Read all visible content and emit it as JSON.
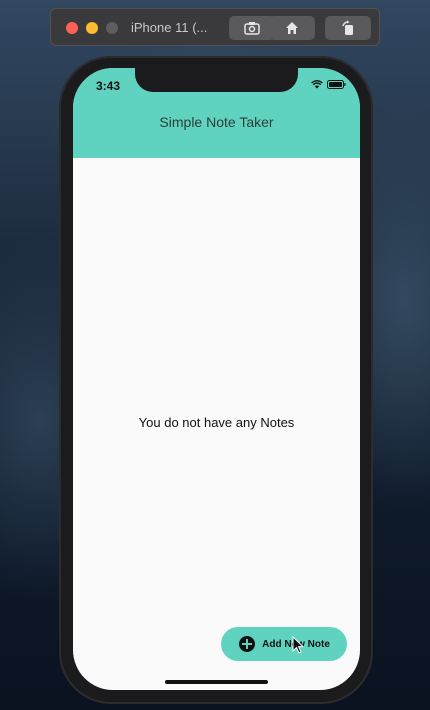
{
  "simulator": {
    "title": "iPhone 11 (...",
    "buttons": [
      "screenshot-icon",
      "home-icon",
      "rotate-icon"
    ]
  },
  "status_bar": {
    "time": "3:43",
    "icons": [
      "wifi-icon",
      "battery-icon"
    ]
  },
  "app": {
    "title": "Simple Note Taker",
    "empty_message": "You do not have any Notes",
    "fab_label": "Add New Note",
    "fab_icon": "plus-circle-icon"
  },
  "colors": {
    "accent": "#5fd3bf",
    "screen_background": "#fafafa"
  }
}
